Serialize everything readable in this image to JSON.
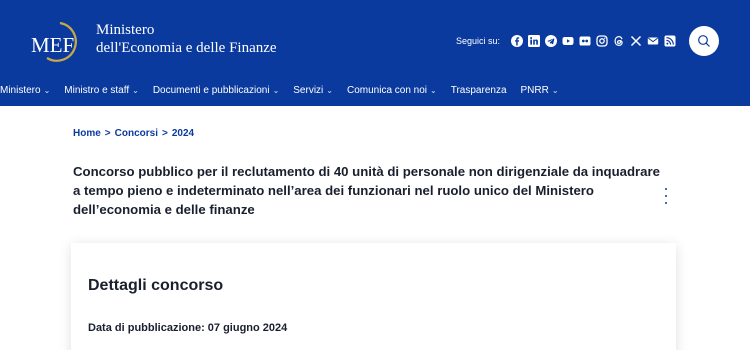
{
  "header": {
    "logo_text": "MEF",
    "title_line1": "Ministero",
    "title_line2": "dell'Economia e delle Finanze",
    "social_label": "Seguici su:",
    "social_icons": [
      "facebook-icon",
      "linkedin-icon",
      "telegram-icon",
      "youtube-icon",
      "flickr-icon",
      "instagram-icon",
      "threads-icon",
      "x-icon",
      "email-icon",
      "rss-icon"
    ],
    "colors": {
      "brand": "#0b3a9e",
      "accent_gold": "#c8a74a"
    }
  },
  "nav": {
    "items": [
      {
        "label": "Ministero",
        "has_dropdown": true
      },
      {
        "label": "Ministro e staff",
        "has_dropdown": true
      },
      {
        "label": "Documenti e pubblicazioni",
        "has_dropdown": true
      },
      {
        "label": "Servizi",
        "has_dropdown": true
      },
      {
        "label": "Comunica con noi",
        "has_dropdown": true
      },
      {
        "label": "Trasparenza",
        "has_dropdown": false
      },
      {
        "label": "PNRR",
        "has_dropdown": true
      }
    ],
    "chevron": "⌄"
  },
  "breadcrumb": {
    "items": [
      "Home",
      "Concorsi",
      "2024"
    ],
    "separator": ">"
  },
  "page": {
    "title": "Concorso pubblico per il reclutamento di 40 unità di personale non dirigenziale da inquadrare a tempo pieno e indeterminato nell’area dei funzionari nel ruolo unico del Ministero dell’economia e delle finanze"
  },
  "card": {
    "title": "Dettagli concorso",
    "date_label": "Data di pubblicazione: 07 giugno 2024"
  }
}
